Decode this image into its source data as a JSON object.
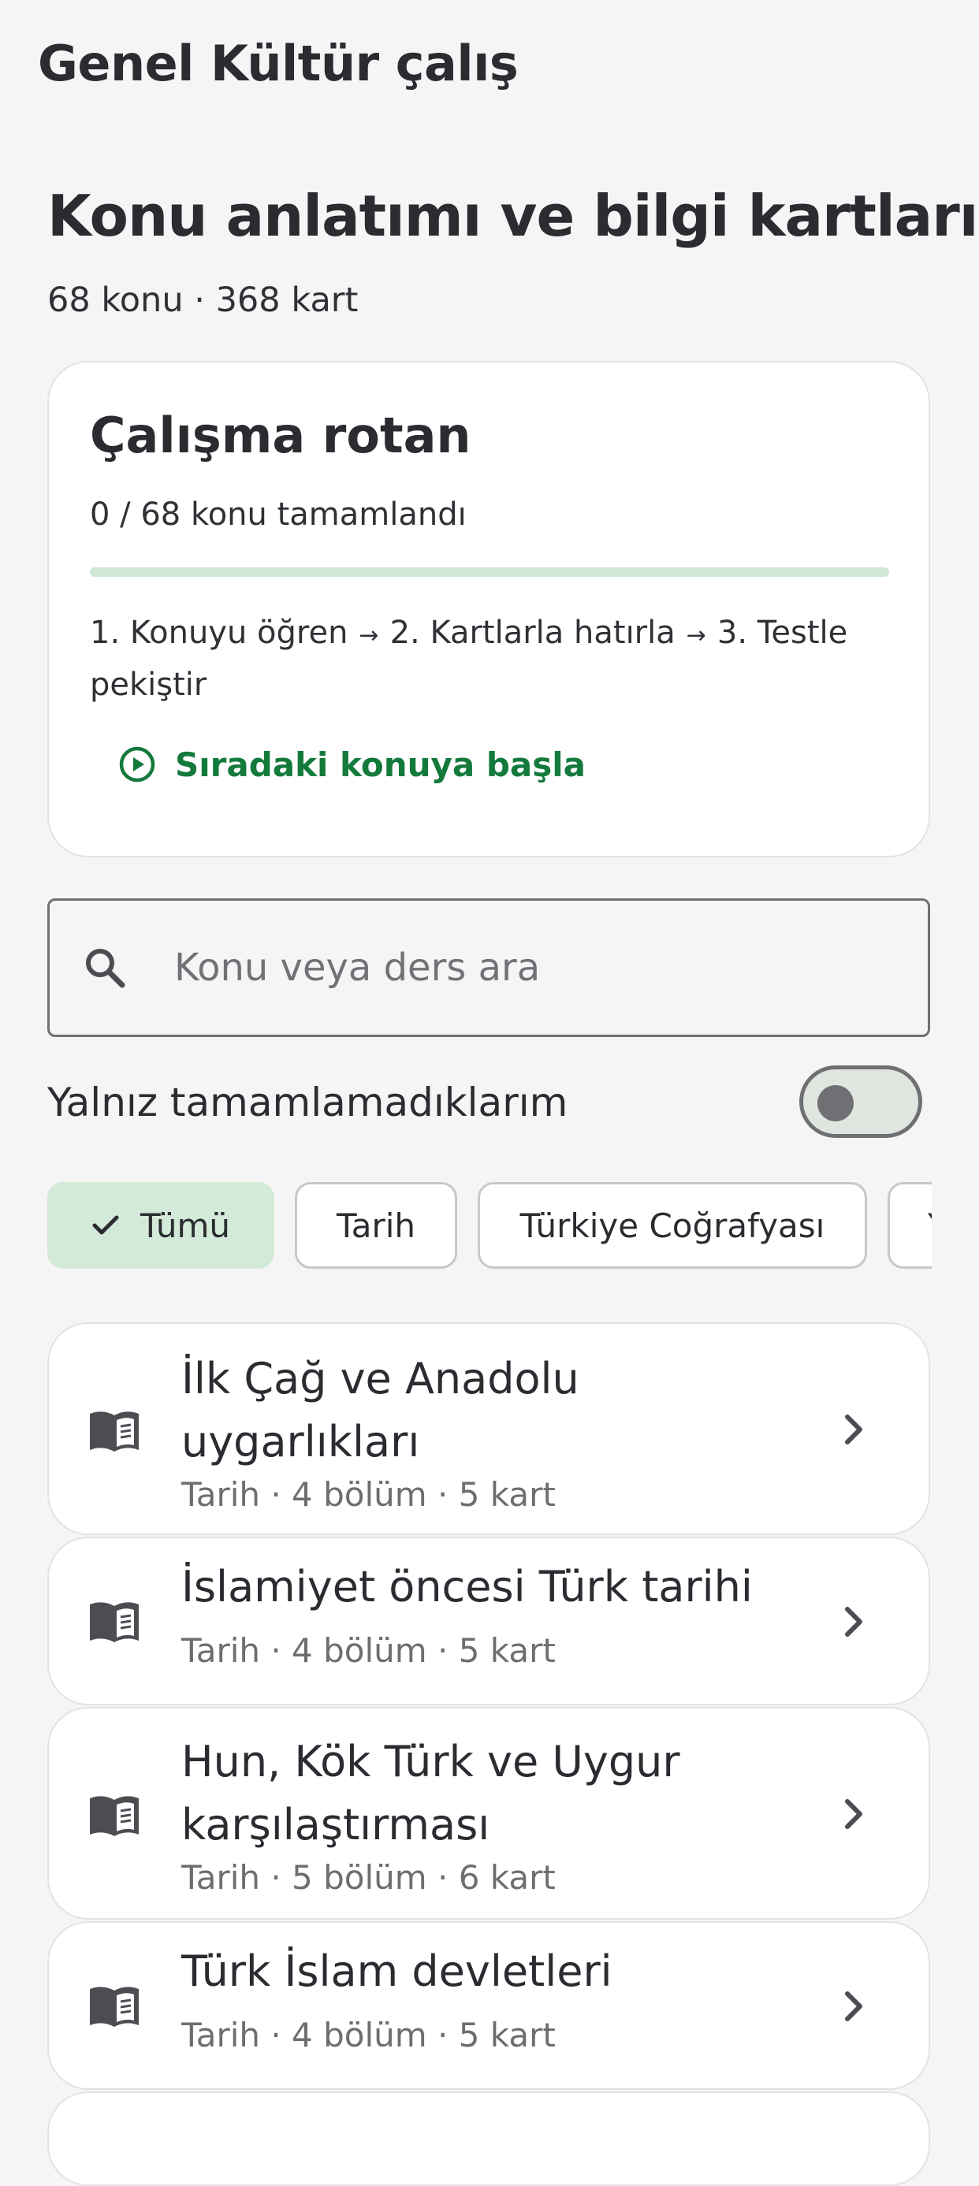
{
  "app": {
    "title": "Genel Kültür çalış"
  },
  "header": {
    "title": "Konu anlatımı ve bilgi kartları",
    "subtitle": "68 konu · 368 kart"
  },
  "route_card": {
    "title": "Çalışma rotan",
    "progress_text": "0 / 68 konu tamamlandı",
    "progress_completed": 0,
    "progress_total": 68,
    "steps": [
      "1. Konuyu öğren",
      "2. Kartlarla hatırla",
      "3. Testle pekiştir"
    ],
    "arrow_glyph": "→",
    "next_button_label": "Sıradaki konuya başla",
    "next_button_icon": "play-circle-icon"
  },
  "search": {
    "placeholder": "Konu veya ders ara",
    "value": ""
  },
  "filter": {
    "incomplete_only_label": "Yalnız tamamlamadıklarım",
    "incomplete_only": false
  },
  "chips": [
    {
      "label": "Tümü",
      "selected": true
    },
    {
      "label": "Tarih",
      "selected": false
    },
    {
      "label": "Türkiye Coğrafyası",
      "selected": false
    },
    {
      "label": "Y",
      "selected": false
    }
  ],
  "topics": [
    {
      "title": "İlk Çağ ve Anadolu uygarlıkları",
      "meta": "Tarih · 4 bölüm · 5 kart"
    },
    {
      "title": "İslamiyet öncesi Türk tarihi",
      "meta": "Tarih · 4 bölüm · 5 kart"
    },
    {
      "title": "Hun, Kök Türk ve Uygur karşılaştırması",
      "meta": "Tarih · 5 bölüm · 6 kart"
    },
    {
      "title": "Türk İslam devletleri",
      "meta": "Tarih · 4 bölüm · 5 kart"
    }
  ],
  "colors": {
    "accent": "#137a3c",
    "accent_light": "#d4ead8",
    "background": "#f5f5f5",
    "card": "#ffffff",
    "text": "#2a2c31",
    "muted": "#6d6e72"
  }
}
